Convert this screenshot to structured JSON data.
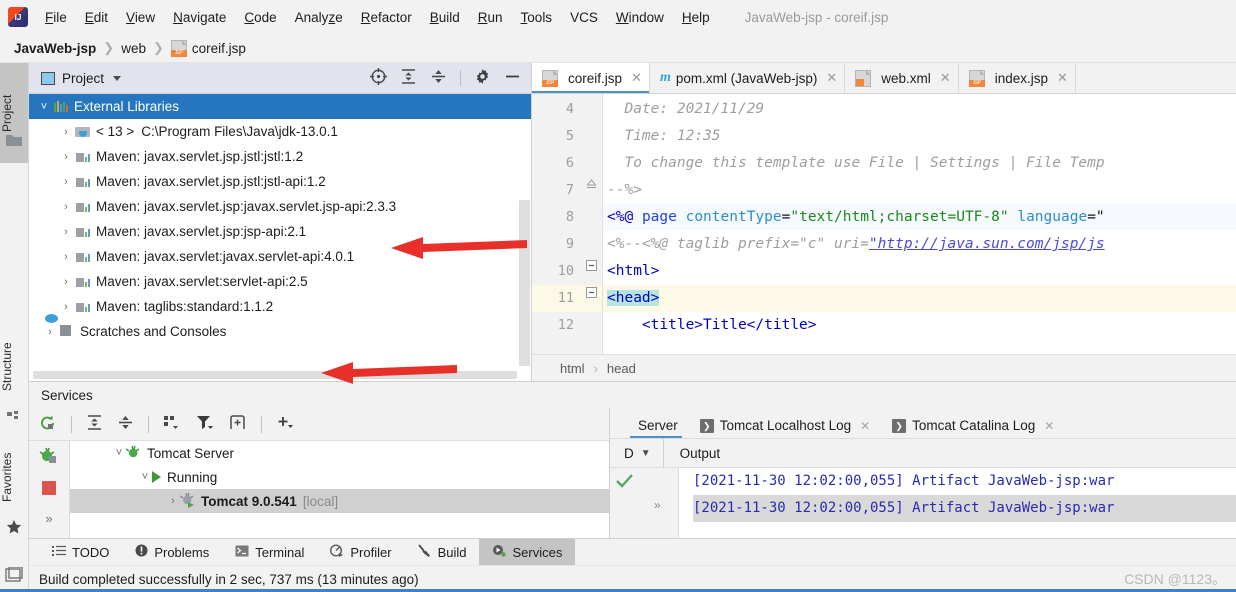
{
  "window": {
    "title": "JavaWeb-jsp - coreif.jsp"
  },
  "menubar": {
    "items": [
      {
        "label": "File",
        "mnemonic": "F"
      },
      {
        "label": "Edit",
        "mnemonic": "E"
      },
      {
        "label": "View",
        "mnemonic": "V"
      },
      {
        "label": "Navigate",
        "mnemonic": "N"
      },
      {
        "label": "Code",
        "mnemonic": "C"
      },
      {
        "label": "Analyze",
        "mnemonic": "z"
      },
      {
        "label": "Refactor",
        "mnemonic": "R"
      },
      {
        "label": "Build",
        "mnemonic": "B"
      },
      {
        "label": "Run",
        "mnemonic": "R"
      },
      {
        "label": "Tools",
        "mnemonic": "T"
      },
      {
        "label": "VCS",
        "mnemonic": ""
      },
      {
        "label": "Window",
        "mnemonic": "W"
      },
      {
        "label": "Help",
        "mnemonic": "H"
      }
    ]
  },
  "navbar": {
    "project": "JavaWeb-jsp",
    "folder": "web",
    "file": "coreif.jsp"
  },
  "leftstrip": {
    "project_tab": "Project",
    "structure_tab": "Structure",
    "favorites_tab": "Favorites"
  },
  "project_panel": {
    "title": "Project",
    "toolbar_icons": [
      "locate-icon",
      "expand-all-icon",
      "collapse-all-icon",
      "gear-icon",
      "hide-icon"
    ],
    "tree": [
      {
        "label": "External Libraries",
        "indent": 0,
        "icon": "libraries-icon",
        "selected": true,
        "expanded": true,
        "dim": ""
      },
      {
        "label": "< 13 >",
        "indent": 1,
        "icon": "jdk-icon",
        "selected": false,
        "expanded": false,
        "dim": "C:\\Program Files\\Java\\jdk-13.0.1"
      },
      {
        "label": "Maven: javax.servlet.jsp.jstl:jstl:1.2",
        "indent": 1,
        "icon": "maven-lib-icon",
        "selected": false,
        "expanded": false,
        "dim": ""
      },
      {
        "label": "Maven: javax.servlet.jsp.jstl:jstl-api:1.2",
        "indent": 1,
        "icon": "maven-lib-icon",
        "selected": false,
        "expanded": false,
        "dim": ""
      },
      {
        "label": "Maven: javax.servlet.jsp:javax.servlet.jsp-api:2.3.3",
        "indent": 1,
        "icon": "maven-lib-icon",
        "selected": false,
        "expanded": false,
        "dim": ""
      },
      {
        "label": "Maven: javax.servlet.jsp:jsp-api:2.1",
        "indent": 1,
        "icon": "maven-lib-icon",
        "selected": false,
        "expanded": false,
        "dim": ""
      },
      {
        "label": "Maven: javax.servlet:javax.servlet-api:4.0.1",
        "indent": 1,
        "icon": "maven-lib-icon",
        "selected": false,
        "expanded": false,
        "dim": ""
      },
      {
        "label": "Maven: javax.servlet:servlet-api:2.5",
        "indent": 1,
        "icon": "maven-lib-icon",
        "selected": false,
        "expanded": false,
        "dim": ""
      },
      {
        "label": "Maven: taglibs:standard:1.1.2",
        "indent": 1,
        "icon": "maven-lib-icon",
        "selected": false,
        "expanded": false,
        "dim": ""
      },
      {
        "label": "Scratches and Consoles",
        "indent": 0,
        "icon": "scratches-icon",
        "selected": false,
        "expanded": false,
        "dim": ""
      }
    ],
    "annotation_arrows": 2,
    "arrow_color": "#e8302a"
  },
  "editor": {
    "tabs": [
      {
        "label": "coreif.jsp",
        "icon": "jsp-file-icon",
        "active": true
      },
      {
        "label": "pom.xml (JavaWeb-jsp)",
        "icon": "maven-file-icon",
        "active": false
      },
      {
        "label": "web.xml",
        "icon": "web-xml-icon",
        "active": false
      },
      {
        "label": "index.jsp",
        "icon": "jsp-file-icon",
        "active": false
      }
    ],
    "lines": [
      {
        "num": "4",
        "text": "  Date: 2021/11/29"
      },
      {
        "num": "5",
        "text": "  Time: 12:35"
      },
      {
        "num": "6",
        "text": "  To change this template use File | Settings | File Temp"
      },
      {
        "num": "7",
        "text": "--%>"
      },
      {
        "num": "8",
        "text": "<%@ page contentType=\"text/html;charset=UTF-8\" language=\""
      },
      {
        "num": "9",
        "text": "<%--<%@ taglib prefix=\"c\" uri=\"http://java.sun.com/jsp/js"
      },
      {
        "num": "10",
        "text": "<html>"
      },
      {
        "num": "11",
        "text": "<head>"
      },
      {
        "num": "12",
        "text": "    <title>Title</title>"
      }
    ],
    "code": {
      "l4_label": "Date:",
      "l4_value": "2021/11/29",
      "l5_label": "Time:",
      "l5_value": "12:35",
      "l6_text": "To change this template use File | Settings | File Temp",
      "l7_text": "--%>",
      "l8_open": "<%@",
      "l8_kw": "page",
      "l8_attr1": "contentType",
      "l8_val1": "\"text/html;charset=UTF-8\"",
      "l8_attr2": "language",
      "l8_eq": "=\"",
      "l9_pre": "<%--<%@ taglib prefix=\"c\" uri=",
      "l9_url": "\"http://java.sun.com/jsp/js",
      "l10_text": "<html>",
      "l11_text": "<head>",
      "l12_text": "<title>Title</title>"
    },
    "breadcrumb": [
      "html",
      "head"
    ]
  },
  "services": {
    "title": "Services",
    "toolbar_icons": [
      "rerun-icon",
      "expand-all-icon",
      "collapse-all-icon",
      "group-by-icon",
      "filter-icon",
      "add-tab-icon",
      "add-icon"
    ],
    "run_icons": [
      "tomcat-icon",
      "stop-icon",
      "more-icon"
    ],
    "tree": [
      {
        "label": "Tomcat Server",
        "indent": 0,
        "icon": "tomcat-icon",
        "expanded": true,
        "selected": false,
        "bold": false,
        "suffix": ""
      },
      {
        "label": "Running",
        "indent": 1,
        "icon": "run-icon",
        "expanded": true,
        "selected": false,
        "bold": false,
        "suffix": ""
      },
      {
        "label": "Tomcat 9.0.541",
        "indent": 2,
        "icon": "tomcat-run-icon",
        "expanded": false,
        "selected": true,
        "bold": true,
        "suffix": "[local]"
      }
    ],
    "tabs": [
      {
        "label": "Server",
        "icon": "",
        "active": true,
        "closable": false
      },
      {
        "label": "Tomcat Localhost Log",
        "icon": "log-icon",
        "active": false,
        "closable": true
      },
      {
        "label": "Tomcat Catalina Log",
        "icon": "log-icon",
        "active": false,
        "closable": true
      }
    ],
    "output_dropdown": "D",
    "output_label": "Output",
    "console_lines": [
      "[2021-11-30 12:02:00,055] Artifact JavaWeb-jsp:war",
      "[2021-11-30 12:02:00,055] Artifact JavaWeb-jsp:war"
    ]
  },
  "toolbuttons": [
    {
      "label": "TODO",
      "icon": "todo-icon",
      "active": false
    },
    {
      "label": "Problems",
      "icon": "problems-icon",
      "active": false
    },
    {
      "label": "Terminal",
      "icon": "terminal-icon",
      "active": false
    },
    {
      "label": "Profiler",
      "icon": "profiler-icon",
      "active": false
    },
    {
      "label": "Build",
      "icon": "build-icon",
      "active": false
    },
    {
      "label": "Services",
      "icon": "services-icon",
      "active": true
    }
  ],
  "statusbar": {
    "message": "Build completed successfully in 2 sec, 737 ms (13 minutes ago)",
    "watermark": "CSDN @1123。"
  },
  "colors": {
    "selection_blue": "#2675bf",
    "accent_blue": "#3f7fd0",
    "arrow_red": "#e8302a",
    "running_green": "#3c9b37"
  }
}
